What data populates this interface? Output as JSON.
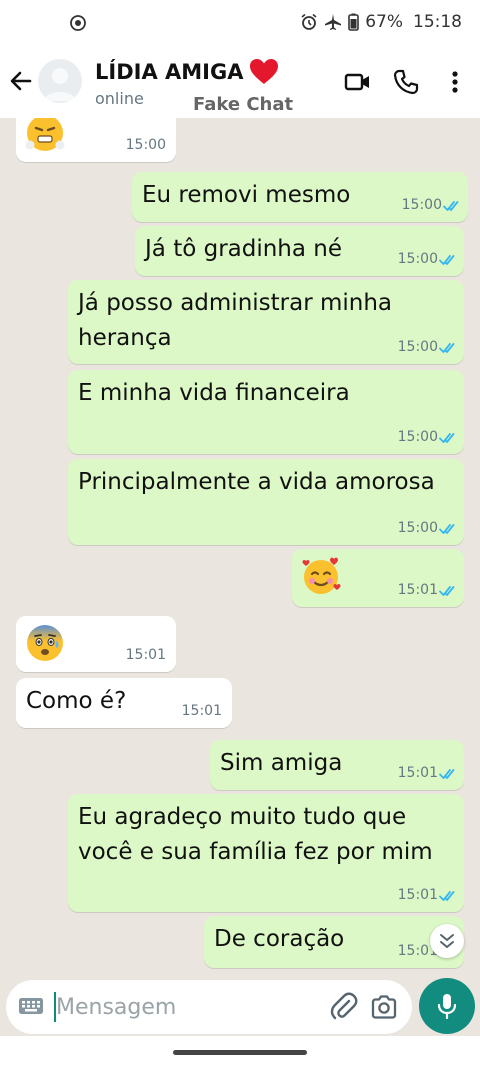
{
  "status_bar": {
    "battery": "67%",
    "time": "15:18"
  },
  "header": {
    "contact_name": "LÍDIA AMIGA",
    "contact_status": "online",
    "watermark": "Fake Chat"
  },
  "messages": [
    {
      "direction": "in",
      "type": "emoji",
      "emoji": "face-with-steam-emoji",
      "time": "15:00"
    },
    {
      "direction": "out",
      "type": "text",
      "text": "Eu removi mesmo",
      "time": "15:00",
      "read": true
    },
    {
      "direction": "out",
      "type": "text",
      "text": "Já tô gradinha né",
      "time": "15:00",
      "read": true
    },
    {
      "direction": "out",
      "type": "text",
      "text": "Já posso administrar minha herança",
      "time": "15:00",
      "read": true
    },
    {
      "direction": "out",
      "type": "text",
      "text": "E minha vida financeira",
      "time": "15:00",
      "read": true
    },
    {
      "direction": "out",
      "type": "text",
      "text": "Principalmente a vida amorosa",
      "time": "15:00",
      "read": true
    },
    {
      "direction": "out",
      "type": "emoji",
      "emoji": "smiling-face-with-hearts-emoji",
      "time": "15:01",
      "read": true
    },
    {
      "direction": "in",
      "type": "emoji",
      "emoji": "anxious-face-emoji",
      "time": "15:01"
    },
    {
      "direction": "in",
      "type": "text",
      "text": "Como é?",
      "time": "15:01"
    },
    {
      "direction": "out",
      "type": "text",
      "text": "Sim amiga",
      "time": "15:01",
      "read": true
    },
    {
      "direction": "out",
      "type": "text",
      "text": "Eu agradeço muito tudo que você e sua família fez por mim",
      "time": "15:01",
      "read": true
    },
    {
      "direction": "out",
      "type": "text",
      "text": "De coração",
      "time": "15:01",
      "read": true
    }
  ],
  "input": {
    "placeholder": "Mensagem",
    "value": ""
  },
  "colors": {
    "outgoing_bubble": "#dcf8c6",
    "incoming_bubble": "#ffffff",
    "chat_background": "#eae6df",
    "accent": "#128c7e",
    "read_tick": "#34b7f1"
  },
  "icons": {
    "back": "arrow-left-icon",
    "video": "video-camera-icon",
    "call": "phone-icon",
    "menu": "more-vert-icon",
    "heart": "red-heart-icon",
    "keyboard": "keyboard-icon",
    "attach": "paperclip-icon",
    "camera": "camera-icon",
    "mic": "microphone-icon",
    "scroll_down": "double-chevron-down-icon"
  }
}
